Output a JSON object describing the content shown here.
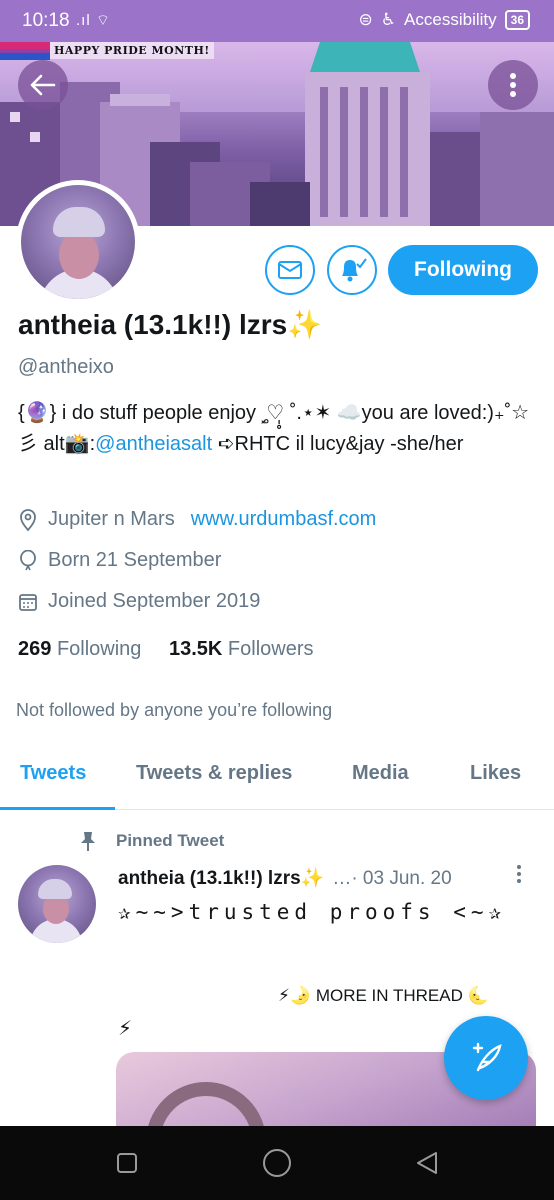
{
  "status_bar": {
    "time": "10:18",
    "signal": ".ıl",
    "right_label": "Accessibility",
    "battery": "36"
  },
  "banner": {
    "pride_text": "HAPPY PRIDE MONTH!"
  },
  "profile": {
    "name": "antheia (13.1k!!) lzrs✨",
    "handle": "@antheixo",
    "bio_part1": "{🔮} i do stuff people enjoy ⸼̥♡̩̥ ˚.⋆✶ ☁️you are loved:)₊˚☆彡 alt📸:",
    "bio_link": "@antheiasalt",
    "bio_part2": " ➪RHTC il lucy&jay -she/her",
    "location": "Jupiter n Mars",
    "website": "www.urdumbasf.com",
    "born": "Born 21 September",
    "joined": "Joined September 2019",
    "following_count": "269",
    "following_label": "Following",
    "followers_count": "13.5K",
    "followers_label": "Followers",
    "not_followed_text": "Not followed by anyone you’re following",
    "follow_button": "Following"
  },
  "tabs": [
    {
      "label": "Tweets",
      "active": true
    },
    {
      "label": "Tweets & replies",
      "active": false
    },
    {
      "label": "Media",
      "active": false
    },
    {
      "label": "Likes",
      "active": false
    }
  ],
  "pinned_tweet": {
    "pinned_label": "Pinned Tweet",
    "name": "antheia (13.1k!!) lzrs✨",
    "date": "…· 03 Jun. 20",
    "text": "✰~~>trusted proofs <~✰",
    "thread_label": "⚡🌛 MORE IN THREAD 🌜",
    "thread_emoji": "⚡"
  },
  "colors": {
    "accent": "#1da1f2",
    "secondary_text": "#657786",
    "status_bar": "#9b74c9"
  },
  "icons": {
    "back": "arrow-left-icon",
    "overflow": "more-vertical-icon",
    "message": "envelope-icon",
    "notifications": "bell-check-icon",
    "location": "location-pin-icon",
    "birthday": "balloon-icon",
    "joined": "calendar-icon",
    "pin": "pin-icon",
    "compose": "compose-feather-icon"
  }
}
